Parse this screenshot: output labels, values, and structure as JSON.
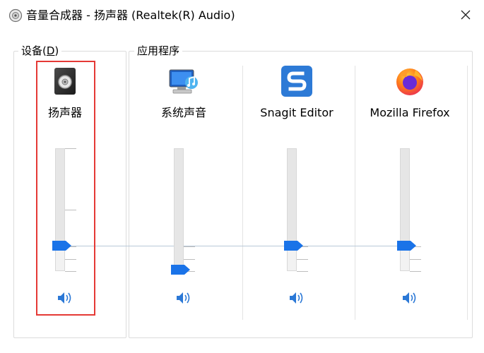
{
  "window": {
    "title": "音量合成器 - 扬声器 (Realtek(R) Audio)",
    "icons": {
      "app": "mixer-icon",
      "close": "close-icon"
    }
  },
  "groups": {
    "device": {
      "label": "设备(D)",
      "underline_index": 3
    },
    "applications": {
      "label": "应用程序"
    }
  },
  "channels": [
    {
      "id": "speakers",
      "label": "扬声器",
      "icon": "speaker-device-icon",
      "volume_percent": 21
    },
    {
      "id": "system",
      "label": "系统声音",
      "icon": "system-sounds-icon",
      "volume_percent": 2
    },
    {
      "id": "snagit",
      "label": "Snagit Editor",
      "icon": "snagit-icon",
      "volume_percent": 21
    },
    {
      "id": "firefox",
      "label": "Mozilla Firefox",
      "icon": "firefox-icon",
      "volume_percent": 21
    }
  ],
  "colors": {
    "thumb": "#1a73e8",
    "speaker_glyph": "#2b78d6",
    "highlight": "#e53935",
    "link_line": "#b9c9d9"
  }
}
